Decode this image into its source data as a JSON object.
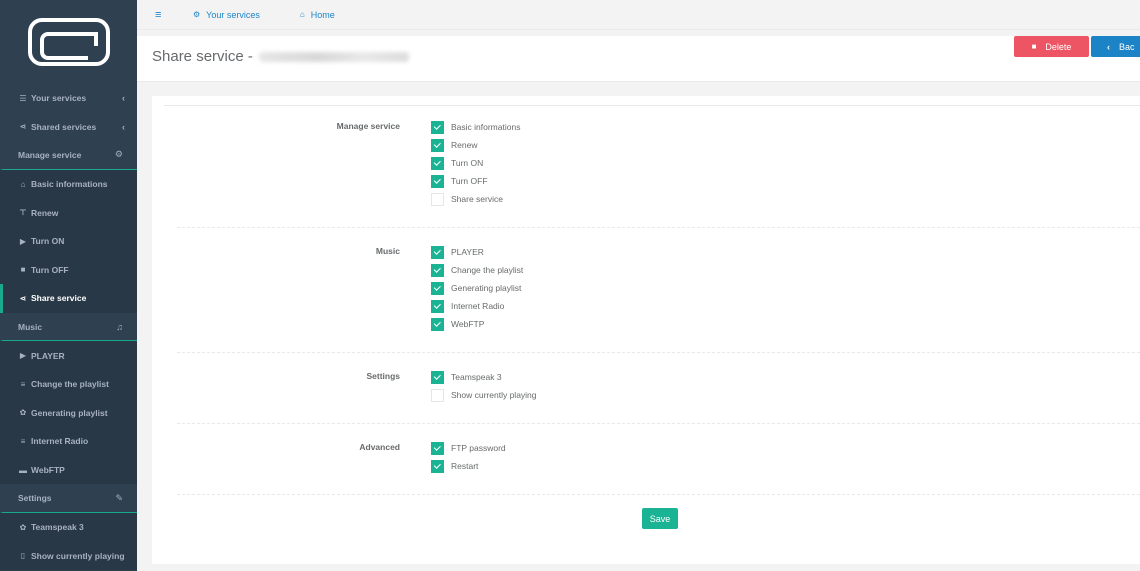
{
  "sidebar": {
    "items": [
      {
        "icon": "list-icon",
        "glyph": "☰",
        "label": "Your services",
        "type": "nav",
        "chevron": "‹"
      },
      {
        "icon": "share-icon",
        "glyph": "⋖",
        "label": "Shared services",
        "type": "nav",
        "chevron": "‹"
      },
      {
        "icon": "gears-icon",
        "glyph": "⚙",
        "label": "Manage service",
        "type": "section"
      },
      {
        "icon": "home-icon",
        "glyph": "⌂",
        "label": "Basic informations",
        "type": "sub"
      },
      {
        "icon": "cart-icon",
        "glyph": "⊤",
        "label": "Renew",
        "type": "sub"
      },
      {
        "icon": "play-icon",
        "glyph": "▶",
        "label": "Turn ON",
        "type": "sub"
      },
      {
        "icon": "stop-icon",
        "glyph": "■",
        "label": "Turn OFF",
        "type": "sub"
      },
      {
        "icon": "share-icon",
        "glyph": "⋖",
        "label": "Share service",
        "type": "active"
      },
      {
        "icon": "music-icon",
        "glyph": "♫",
        "label": "Music",
        "type": "section"
      },
      {
        "icon": "play-icon",
        "glyph": "▶",
        "label": "PLAYER",
        "type": "sub"
      },
      {
        "icon": "list-icon",
        "glyph": "≡",
        "label": "Change the playlist",
        "type": "sub"
      },
      {
        "icon": "gear-icon",
        "glyph": "✿",
        "label": "Generating playlist",
        "type": "sub"
      },
      {
        "icon": "rss-icon",
        "glyph": "≡",
        "label": "Internet Radio",
        "type": "sub"
      },
      {
        "icon": "folder-icon",
        "glyph": "▬",
        "label": "WebFTP",
        "type": "sub"
      },
      {
        "icon": "wrench-icon",
        "glyph": "✎",
        "label": "Settings",
        "type": "section"
      },
      {
        "icon": "gear-icon",
        "glyph": "✿",
        "label": "Teamspeak 3",
        "type": "sub"
      },
      {
        "icon": "file-icon",
        "glyph": "▯",
        "label": "Show currently playing",
        "type": "sub"
      }
    ]
  },
  "topbar": {
    "menu_glyph": "≡",
    "your_services_label": "Your services",
    "home_label": "Home"
  },
  "header": {
    "title": "Share service -",
    "delete_label": "Delete",
    "back_label": "Bac"
  },
  "groups": [
    {
      "label": "Manage service",
      "options": [
        {
          "label": "Basic informations",
          "checked": true
        },
        {
          "label": "Renew",
          "checked": true
        },
        {
          "label": "Turn ON",
          "checked": true
        },
        {
          "label": "Turn OFF",
          "checked": true
        },
        {
          "label": "Share service",
          "checked": false
        }
      ]
    },
    {
      "label": "Music",
      "options": [
        {
          "label": "PLAYER",
          "checked": true
        },
        {
          "label": "Change the playlist",
          "checked": true
        },
        {
          "label": "Generating playlist",
          "checked": true
        },
        {
          "label": "Internet Radio",
          "checked": true
        },
        {
          "label": "WebFTP",
          "checked": true
        }
      ]
    },
    {
      "label": "Settings",
      "options": [
        {
          "label": "Teamspeak 3",
          "checked": true
        },
        {
          "label": "Show currently playing",
          "checked": false
        }
      ]
    },
    {
      "label": "Advanced",
      "options": [
        {
          "label": "FTP password",
          "checked": true
        },
        {
          "label": "Restart",
          "checked": true
        }
      ]
    }
  ],
  "save_label": "Save",
  "colors": {
    "accent": "#1ab394",
    "danger": "#ed5565",
    "primary": "#1c84c6",
    "sidebar": "#2f4050"
  }
}
